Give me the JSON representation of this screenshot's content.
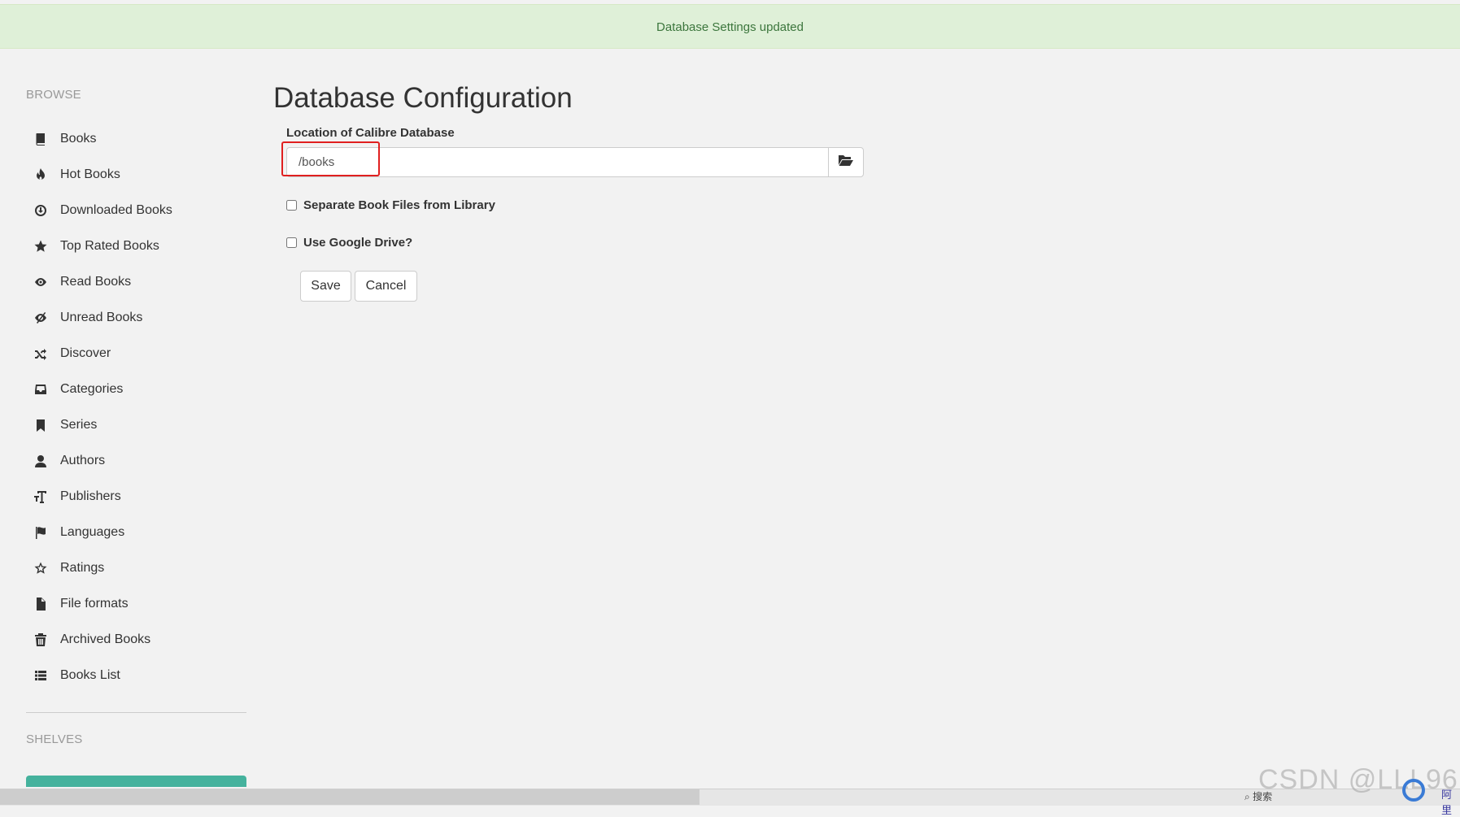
{
  "alert": {
    "message": "Database Settings updated"
  },
  "sidebar": {
    "browse_header": "BROWSE",
    "items": [
      {
        "label": "Books",
        "icon": "book-icon"
      },
      {
        "label": "Hot Books",
        "icon": "fire-icon"
      },
      {
        "label": "Downloaded Books",
        "icon": "download-icon"
      },
      {
        "label": "Top Rated Books",
        "icon": "star-icon"
      },
      {
        "label": "Read Books",
        "icon": "eye-icon"
      },
      {
        "label": "Unread Books",
        "icon": "eye-slash-icon"
      },
      {
        "label": "Discover",
        "icon": "shuffle-icon"
      },
      {
        "label": "Categories",
        "icon": "inbox-icon"
      },
      {
        "label": "Series",
        "icon": "bookmark-icon"
      },
      {
        "label": "Authors",
        "icon": "user-icon"
      },
      {
        "label": "Publishers",
        "icon": "text-size-icon"
      },
      {
        "label": "Languages",
        "icon": "flag-icon"
      },
      {
        "label": "Ratings",
        "icon": "star-empty-icon"
      },
      {
        "label": "File formats",
        "icon": "file-icon"
      },
      {
        "label": "Archived Books",
        "icon": "trash-icon"
      },
      {
        "label": "Books List",
        "icon": "list-icon"
      }
    ],
    "shelves_header": "SHELVES"
  },
  "main": {
    "title": "Database Configuration",
    "location_label": "Location of Calibre Database",
    "location_value": "/books",
    "folder_icon": "folder-open-icon",
    "separate_label": "Separate Book Files from Library",
    "separate_checked": false,
    "gdrive_label": "Use Google Drive?",
    "gdrive_checked": false,
    "save_label": "Save",
    "cancel_label": "Cancel"
  },
  "overlay": {
    "watermark": "CSDN @LLL96",
    "taskbar_search": "搜索",
    "tray_text": "阿里"
  },
  "colors": {
    "alert_bg": "#dff0d8",
    "alert_text": "#3c763d",
    "highlight": "#e02020",
    "shelf_button": "#45b29d"
  }
}
